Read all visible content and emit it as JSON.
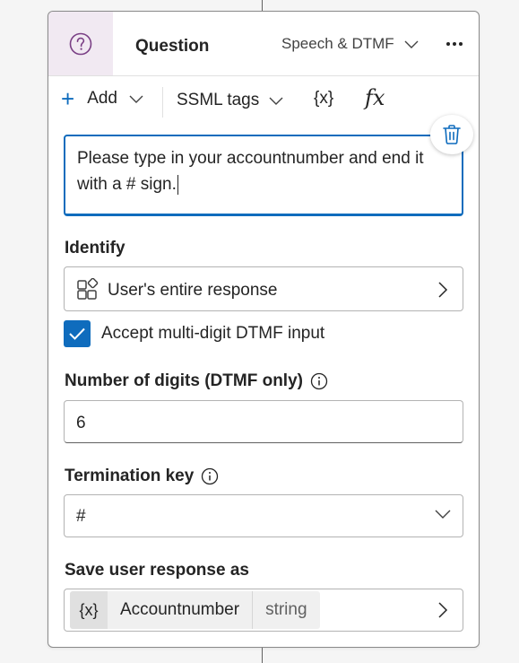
{
  "node": {
    "title": "Question",
    "mode": "Speech & DTMF"
  },
  "toolbar": {
    "add_label": "Add",
    "ssml_label": "SSML tags",
    "variable_label": "{x}",
    "formula_label": "fx"
  },
  "prompt": {
    "value": "Please type in your accountnumber and end it with a # sign."
  },
  "identify": {
    "label": "Identify",
    "value": "User's entire response"
  },
  "multi_digit": {
    "label": "Accept multi-digit DTMF input",
    "checked": true
  },
  "digits": {
    "label": "Number of digits (DTMF only)",
    "value": "6"
  },
  "termination": {
    "label": "Termination key",
    "value": "#"
  },
  "save": {
    "label": "Save user response as",
    "variable_icon": "{x}",
    "variable_name": "Accountnumber",
    "variable_type": "string"
  },
  "colors": {
    "accent": "#0f6cbd",
    "header_icon_bg": "#f1e9f2",
    "header_icon": "#7a3f85"
  }
}
